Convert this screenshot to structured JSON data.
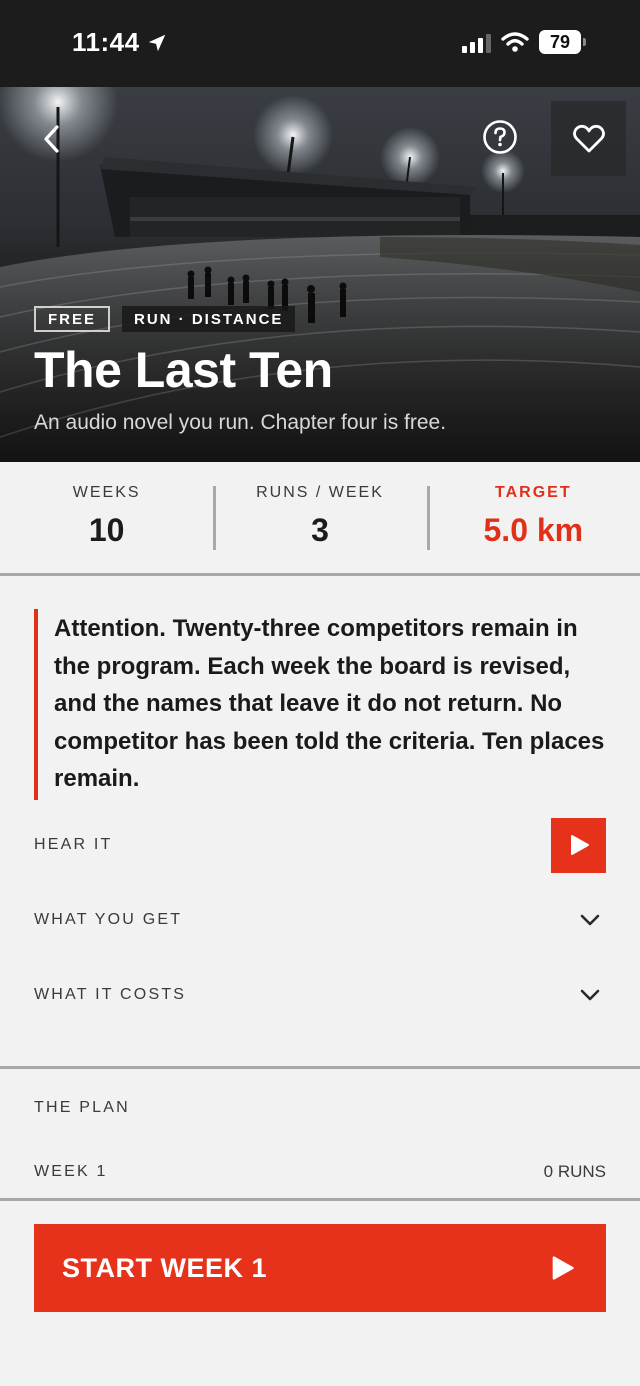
{
  "status_bar": {
    "time": "11:44",
    "battery": "79"
  },
  "hero": {
    "badges": [
      "FREE",
      "RUN · DISTANCE"
    ],
    "title": "The Last Ten",
    "subtitle": "An audio novel you run. Chapter four is free."
  },
  "stats": [
    {
      "label": "WEEKS",
      "value": "10"
    },
    {
      "label": "RUNS / WEEK",
      "value": "3"
    },
    {
      "label": "TARGET",
      "value": "5.0 km"
    }
  ],
  "quote": "Attention. Twenty-three competitors remain in the program. Each week the board is revised, and the names that leave it do not return. No competitor has been told the criteria. Ten places remain.",
  "sections": {
    "hear_it": "HEAR IT",
    "what_you_get": "WHAT YOU GET",
    "what_it_costs": "WHAT IT COSTS"
  },
  "plan": {
    "title": "THE PLAN",
    "week_label": "WEEK 1",
    "week_runs": "0 RUNS"
  },
  "cta": {
    "label": "START WEEK 1"
  },
  "colors": {
    "accent": "#e6311b",
    "status_bar_bg": "#1c1c1c",
    "page_bg": "#f2f2f2"
  },
  "icons": [
    "location-arrow-icon",
    "signal-icon",
    "wifi-icon",
    "battery-icon",
    "back-chevron-icon",
    "help-icon",
    "heart-icon",
    "play-icon",
    "chevron-down-icon"
  ]
}
